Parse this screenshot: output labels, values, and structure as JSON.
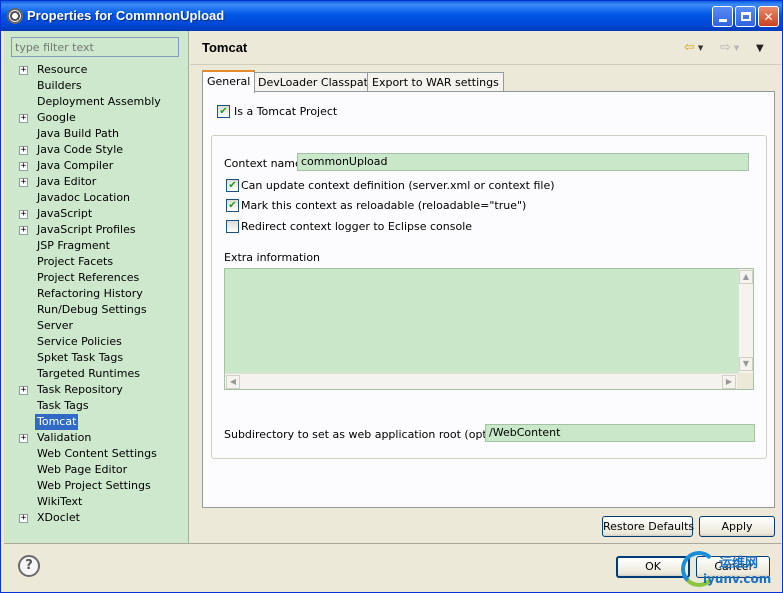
{
  "window": {
    "title": "Properties for CommnonUpload"
  },
  "sidebar": {
    "filter_placeholder": "type filter text",
    "items": [
      {
        "label": "Resource",
        "expandable": true
      },
      {
        "label": "Builders",
        "expandable": false
      },
      {
        "label": "Deployment Assembly",
        "expandable": false
      },
      {
        "label": "Google",
        "expandable": true
      },
      {
        "label": "Java Build Path",
        "expandable": false
      },
      {
        "label": "Java Code Style",
        "expandable": true
      },
      {
        "label": "Java Compiler",
        "expandable": true
      },
      {
        "label": "Java Editor",
        "expandable": true
      },
      {
        "label": "Javadoc Location",
        "expandable": false
      },
      {
        "label": "JavaScript",
        "expandable": true
      },
      {
        "label": "JavaScript Profiles",
        "expandable": true
      },
      {
        "label": "JSP Fragment",
        "expandable": false
      },
      {
        "label": "Project Facets",
        "expandable": false
      },
      {
        "label": "Project References",
        "expandable": false
      },
      {
        "label": "Refactoring History",
        "expandable": false
      },
      {
        "label": "Run/Debug Settings",
        "expandable": false
      },
      {
        "label": "Server",
        "expandable": false
      },
      {
        "label": "Service Policies",
        "expandable": false
      },
      {
        "label": "Spket Task Tags",
        "expandable": false
      },
      {
        "label": "Targeted Runtimes",
        "expandable": false
      },
      {
        "label": "Task Repository",
        "expandable": true
      },
      {
        "label": "Task Tags",
        "expandable": false
      },
      {
        "label": "Tomcat",
        "expandable": false,
        "selected": true
      },
      {
        "label": "Validation",
        "expandable": true
      },
      {
        "label": "Web Content Settings",
        "expandable": false
      },
      {
        "label": "Web Page Editor",
        "expandable": false
      },
      {
        "label": "Web Project Settings",
        "expandable": false
      },
      {
        "label": "WikiText",
        "expandable": false
      },
      {
        "label": "XDoclet",
        "expandable": true
      }
    ]
  },
  "page": {
    "title": "Tomcat",
    "tabs": [
      {
        "label": "General",
        "active": true
      },
      {
        "label": "DevLoader Classpath",
        "active": false
      },
      {
        "label": "Export to WAR settings",
        "active": false
      }
    ],
    "is_tomcat_project": {
      "label": "Is a Tomcat Project",
      "checked": true
    },
    "context_name": {
      "label": "Context name",
      "value": "commonUpload"
    },
    "can_update_context": {
      "label": "Can update context definition (server.xml or context file)",
      "checked": true
    },
    "mark_reloadable": {
      "label": "Mark this context as reloadable (reloadable=\"true\")",
      "checked": true
    },
    "redirect_logger": {
      "label": "Redirect context logger to Eclipse console",
      "checked": false
    },
    "extra_info": {
      "label": "Extra information",
      "value": ""
    },
    "subdirectory": {
      "label": "Subdirectory to set as web application root (optional)",
      "value": "/WebContent"
    },
    "restore_defaults_label": "Restore Defaults",
    "apply_label": "Apply"
  },
  "footer": {
    "ok_label": "OK",
    "cancel_label": "Cancel"
  },
  "watermark": {
    "top": "运维网",
    "bottom": "iyunv.com"
  },
  "icons": {
    "window": "gear-icon",
    "help": "help-icon",
    "back": "back-arrow-icon",
    "forward": "forward-arrow-icon",
    "view_menu": "view-menu-icon"
  },
  "colors": {
    "title_bar": "#0058e6",
    "sidebar_bg": "#cde8cd",
    "field_bg": "#c9e8c9",
    "selection": "#316ac5",
    "active_tab_accent": "#e68b2c",
    "check": "#21a121"
  }
}
